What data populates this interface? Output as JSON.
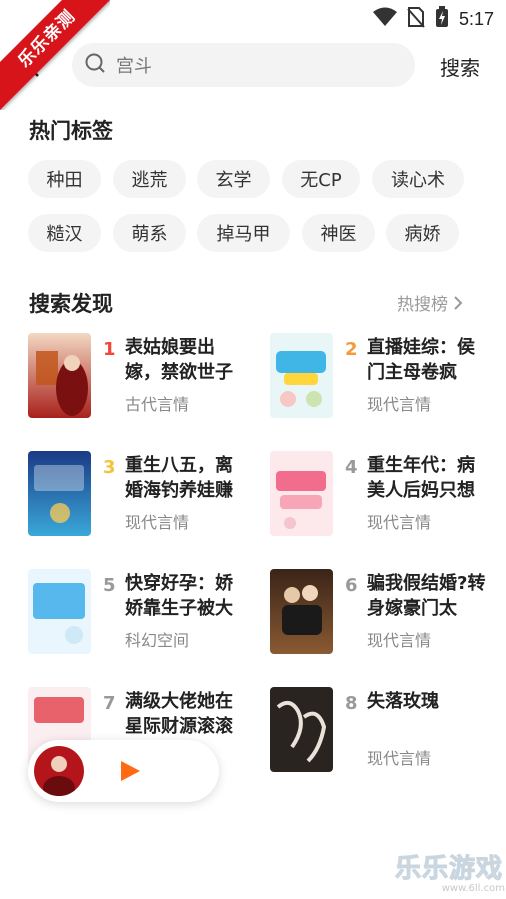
{
  "status": {
    "time": "5:17"
  },
  "watermark": {
    "ribbon": "乐乐亲测",
    "corner_title": "乐乐游戏",
    "corner_url": "www.6ll.com"
  },
  "search": {
    "query": "宫斗",
    "button": "搜索"
  },
  "hot_tags": {
    "title": "热门标签",
    "row1": [
      "种田",
      "逃荒",
      "玄学",
      "无CP",
      "读心术"
    ],
    "row2": [
      "糙汉",
      "萌系",
      "掉马甲",
      "神医",
      "病娇"
    ]
  },
  "discover": {
    "title": "搜索发现",
    "hot_link": "热搜榜",
    "books": [
      {
        "rank": "1",
        "title": "表姑娘要出嫁，禁欲世子",
        "category": "古代言情",
        "rank_color": "#f0473c"
      },
      {
        "rank": "2",
        "title": "直播娃综：侯门主母卷疯",
        "category": "现代言情",
        "rank_color": "#f59a3b"
      },
      {
        "rank": "3",
        "title": "重生八五，离婚海钓养娃赚",
        "category": "现代言情",
        "rank_color": "#f3c43b"
      },
      {
        "rank": "4",
        "title": "重生年代：病美人后妈只想",
        "category": "现代言情",
        "rank_color": "#999999"
      },
      {
        "rank": "5",
        "title": "快穿好孕：娇娇靠生子被大",
        "category": "科幻空间",
        "rank_color": "#999999"
      },
      {
        "rank": "6",
        "title": "骗我假结婚?转身嫁豪门太",
        "category": "现代言情",
        "rank_color": "#999999"
      },
      {
        "rank": "7",
        "title": "满级大佬她在星际财源滚滚",
        "category": "",
        "rank_color": "#999999"
      },
      {
        "rank": "8",
        "title": "失落玫瑰",
        "category": "现代言情",
        "rank_color": "#999999"
      }
    ]
  },
  "colors": {
    "accent": "#ff6a13"
  }
}
